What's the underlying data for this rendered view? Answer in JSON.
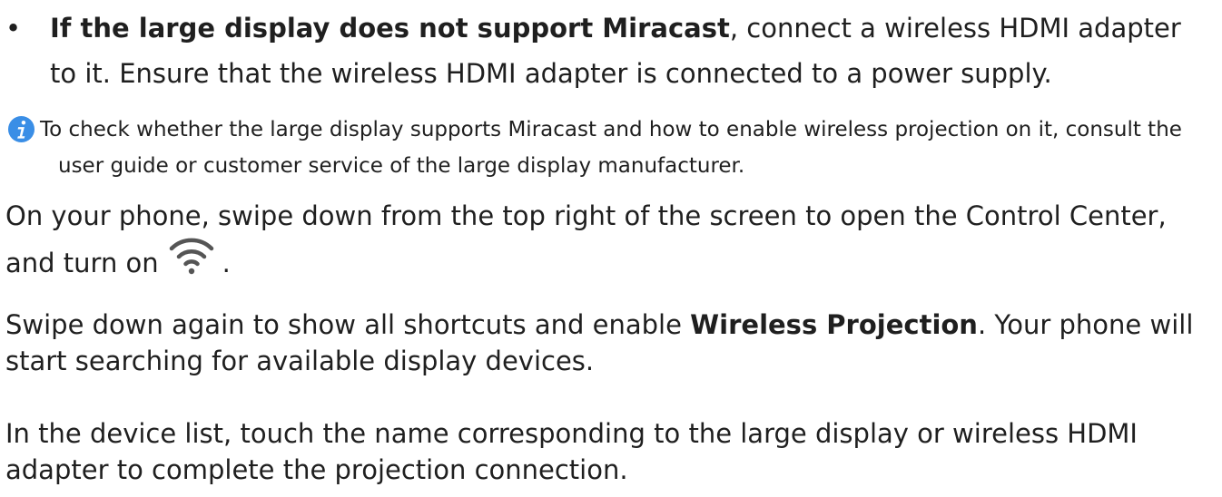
{
  "bullet": {
    "marker": "•",
    "bold_lead": "If the large display does not support Miracast",
    "rest": ", connect a wireless HDMI adapter to it. Ensure that the wireless HDMI adapter is connected to a power supply."
  },
  "note": {
    "icon": "info-icon",
    "icon_color": "#3a8ee6",
    "text": "To check whether the large display supports Miracast and how to enable wireless projection on it, consult the user guide or customer service of the large display manufacturer."
  },
  "steps": {
    "step1_line1": "On your phone, swipe down from the top right of the screen to open the Control Center,",
    "step1_line2_before": "and turn on",
    "step1_icon": "wifi-icon",
    "step1_line2_after": ".",
    "step2_before": "Swipe down again to show all shortcuts and enable ",
    "step2_bold": "Wireless Projection",
    "step2_after": ". Your phone will start searching for available display devices.",
    "step3": "In the device list, touch the name corresponding to the large display or wireless HDMI adapter to complete the projection connection."
  }
}
